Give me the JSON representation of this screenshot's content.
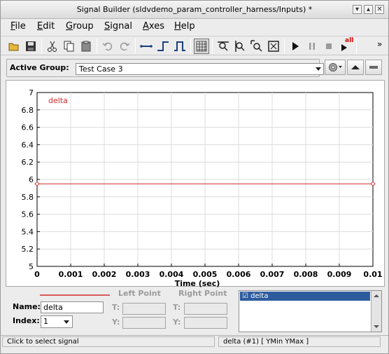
{
  "window": {
    "title": "Signal Builder (sldvdemo_param_controller_harness/Inputs) *",
    "minimize_glyph": "▾",
    "maximize_glyph": "▴",
    "close_glyph": "✕"
  },
  "menu": {
    "items": [
      {
        "key": "F",
        "rest": "ile"
      },
      {
        "key": "E",
        "rest": "dit"
      },
      {
        "key": "G",
        "rest": "roup"
      },
      {
        "key": "S",
        "rest": "ignal"
      },
      {
        "key": "A",
        "rest": "xes"
      },
      {
        "key": "H",
        "rest": "elp"
      }
    ]
  },
  "toolbar": {
    "icons": [
      "open-icon",
      "save-icon",
      "cut-icon",
      "copy-icon",
      "paste-icon",
      "undo-icon",
      "redo-icon",
      "constant-signal-icon",
      "step-signal-icon",
      "pulse-signal-icon",
      "grid-icon",
      "zoom-x-icon",
      "zoom-y-icon",
      "zoom-xy-icon",
      "fit-icon",
      "play-icon",
      "pause-icon",
      "stop-icon",
      "play-all-icon"
    ],
    "play_all_label": "all",
    "overflow_glyph": "»"
  },
  "group": {
    "label": "Active Group:",
    "selected": "Test Case 3"
  },
  "plot": {
    "signal_label": "delta",
    "signal_color": "#d22b2b",
    "xlabel": "Time (sec)"
  },
  "chart_data": {
    "type": "line",
    "series": [
      {
        "name": "delta",
        "x": [
          0,
          0.01
        ],
        "values": [
          5.95,
          5.95
        ]
      }
    ],
    "xlabel": "Time (sec)",
    "ylabel": "",
    "xlim": [
      0,
      0.01
    ],
    "ylim": [
      5,
      7
    ],
    "x_ticks": [
      "0",
      "0.001",
      "0.002",
      "0.003",
      "0.004",
      "0.005",
      "0.006",
      "0.007",
      "0.008",
      "0.009",
      "0.01"
    ],
    "y_ticks": [
      "5",
      "5.2",
      "5.4",
      "5.6",
      "5.8",
      "6",
      "6.2",
      "6.4",
      "6.6",
      "6.8",
      "7"
    ],
    "grid": true
  },
  "props": {
    "name_label": "Name:",
    "name_value": "delta",
    "index_label": "Index:",
    "index_value": "1",
    "left_point": "Left Point",
    "right_point": "Right Point",
    "t_label": "T:",
    "y_label": "Y:",
    "signal_list": [
      "☑ delta"
    ]
  },
  "status": {
    "left": "Click to select signal",
    "right": "delta (#1)  [ YMin YMax ]"
  }
}
